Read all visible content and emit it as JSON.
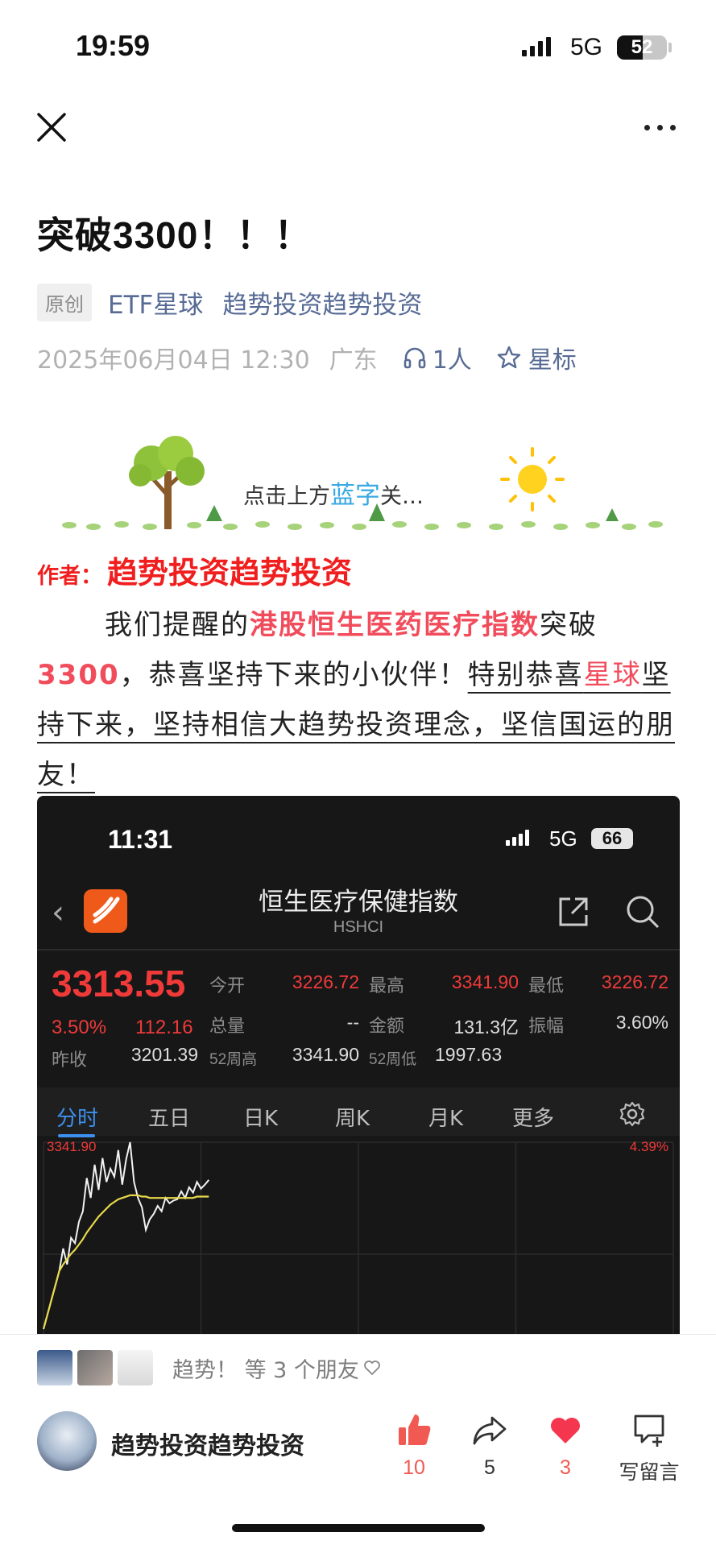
{
  "status_bar": {
    "time": "19:59",
    "network": "5G",
    "battery": "52"
  },
  "article": {
    "title": "突破3300！！！",
    "original_badge": "原创",
    "account_name": "ETF星球",
    "author_name": "趋势投资趋势投资",
    "date": "2025年06月04日 12:30",
    "location": "广东",
    "listeners": "1人",
    "star_label": "星标"
  },
  "banner": {
    "text_prefix": "点击上方",
    "text_blue": "蓝字",
    "text_suffix": "关…"
  },
  "body": {
    "author_label": "作者：",
    "author_name": "趋势投资趋势投资",
    "p1": "我们提醒的",
    "p1_red": "港股恒生医药医疗指数",
    "p1_after": "突破",
    "num": "3300",
    "p2": "，恭喜坚持下来的小伙伴！",
    "p3_a": "特别恭喜",
    "p3_red": "星球",
    "p3_b": "坚持下来，坚持相信大趋势投资理念，坚信国运的朋友！"
  },
  "screenshot": {
    "time": "11:31",
    "network": "5G",
    "battery": "66",
    "index_name": "恒生医疗保健指数",
    "index_code": "HSHCI",
    "price": "3313.55",
    "change_pct": "3.50%",
    "change_abs": "112.16",
    "labels": {
      "open": "今开",
      "high": "最高",
      "low": "最低",
      "volume": "总量",
      "amount": "金额",
      "amplitude": "振幅",
      "prev_close": "昨收",
      "w52_high": "52周高",
      "w52_low": "52周低"
    },
    "values": {
      "open": "3226.72",
      "high": "3341.90",
      "low": "3226.72",
      "volume": "--",
      "amount": "131.3亿",
      "amplitude": "3.60%",
      "prev_close": "3201.39",
      "w52_high": "3341.90",
      "w52_low": "1997.63"
    },
    "tabs": [
      "分时",
      "五日",
      "日K",
      "周K",
      "月K",
      "更多"
    ],
    "chart_high_label": "3341.90",
    "chart_pct_label": "4.39%"
  },
  "chart_data": {
    "type": "line",
    "title": "",
    "ylim": [
      3201.39,
      3341.9
    ],
    "series": [
      {
        "values": [
          3201.39,
          3245,
          3262,
          3250,
          3270,
          3266,
          3282,
          3290,
          3315,
          3300,
          3325,
          3306,
          3330,
          3312,
          3322,
          3316,
          3336,
          3310,
          3329,
          3341.9,
          3312,
          3300,
          3293,
          3276,
          3284,
          3288,
          3294,
          3290,
          3300,
          3296,
          3298,
          3299,
          3305,
          3300,
          3308,
          3304,
          3312,
          3307,
          3310,
          3313.55
        ]
      },
      {
        "values": [
          3201.39,
          3245,
          3250,
          3254,
          3258,
          3261,
          3265,
          3269,
          3274,
          3278,
          3282,
          3286,
          3289,
          3292,
          3295,
          3297,
          3299,
          3300,
          3301,
          3302,
          3302,
          3302,
          3301,
          3301,
          3300,
          3300,
          3300,
          3300,
          3300,
          3300,
          3300,
          3300,
          3300,
          3300,
          3300,
          3300,
          3301,
          3301,
          3301,
          3301
        ]
      }
    ],
    "grid": true
  },
  "bottom": {
    "friends_text": "趋势！ 等 3 个朋友",
    "account_name": "趋势投资趋势投资",
    "like_count": "10",
    "share_count": "5",
    "heart_count": "3",
    "comment_label": "写留言"
  }
}
